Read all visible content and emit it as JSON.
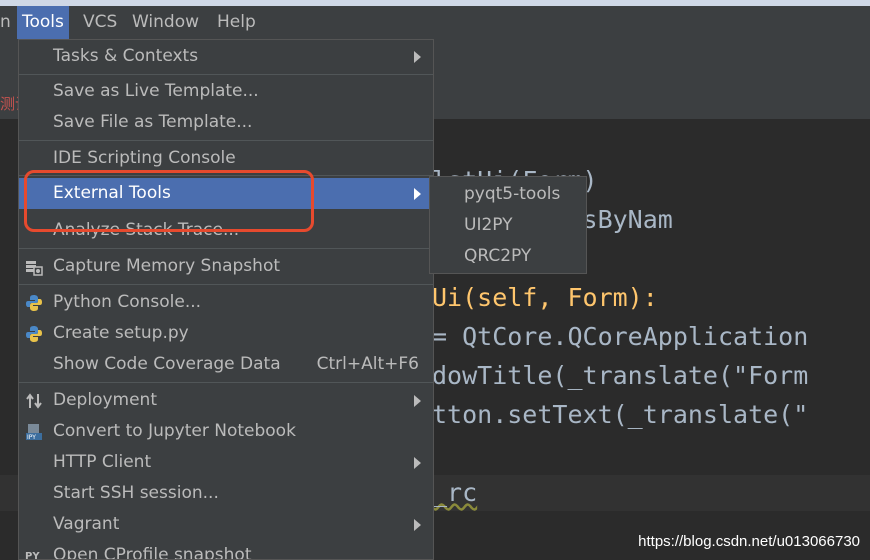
{
  "menubar": {
    "items": [
      {
        "label": "n"
      },
      {
        "label": "Tools"
      },
      {
        "label": "VCS"
      },
      {
        "label": "Window"
      },
      {
        "label": "Help"
      }
    ]
  },
  "background": {
    "red_text": "测试"
  },
  "editor": {
    "lines": [
      {
        "code": "lstUi(Form)"
      },
      {
        "code": "onnectSlotsByNam"
      },
      {
        "code": "Ui(self, Form):"
      },
      {
        "code": "= QtCore.QCoreApplication"
      },
      {
        "code": "dowTitle(_translate(\"Form"
      },
      {
        "code": "tton.setText(_translate(\""
      },
      {
        "code": "_rc"
      }
    ]
  },
  "tools_menu": {
    "items": [
      {
        "label": "Tasks & Contexts"
      },
      {
        "label": "Save as Live Template..."
      },
      {
        "label": "Save File as Template..."
      },
      {
        "label": "IDE Scripting Console"
      },
      {
        "label": "External Tools"
      },
      {
        "label": "Analyze Stack Trace..."
      },
      {
        "label": "Capture Memory Snapshot"
      },
      {
        "label": "Python Console..."
      },
      {
        "label": "Create setup.py"
      },
      {
        "label": "Show Code Coverage Data",
        "shortcut": "Ctrl+Alt+F6"
      },
      {
        "label": "Deployment"
      },
      {
        "label": "Convert to Jupyter Notebook"
      },
      {
        "label": "HTTP Client"
      },
      {
        "label": "Start SSH session..."
      },
      {
        "label": "Vagrant"
      },
      {
        "label": "Open CProfile snapshot"
      }
    ]
  },
  "external_tools_submenu": {
    "items": [
      {
        "label": "pyqt5-tools"
      },
      {
        "label": "UI2PY"
      },
      {
        "label": "QRC2PY"
      }
    ]
  },
  "watermark": "https://blog.csdn.net/u013066730",
  "colors": {
    "menu_bg": "#3c3f41",
    "selection": "#4b6eaf",
    "highlight_box": "#e64a2e",
    "editor_bg": "#2b2b2b"
  }
}
